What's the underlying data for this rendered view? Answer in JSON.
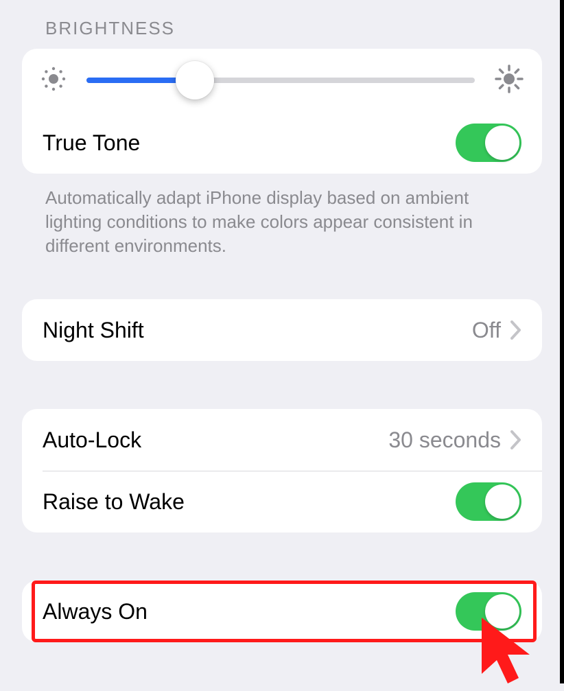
{
  "brightness": {
    "header": "BRIGHTNESS",
    "slider_percent": 28,
    "true_tone_label": "True Tone",
    "true_tone_on": true,
    "footer": "Automatically adapt iPhone display based on ambient lighting conditions to make colors appear consistent in different environments."
  },
  "night_shift": {
    "label": "Night Shift",
    "value": "Off"
  },
  "auto_lock": {
    "label": "Auto-Lock",
    "value": "30 seconds"
  },
  "raise_to_wake": {
    "label": "Raise to Wake",
    "on": true
  },
  "always_on": {
    "label": "Always On",
    "on": true
  }
}
